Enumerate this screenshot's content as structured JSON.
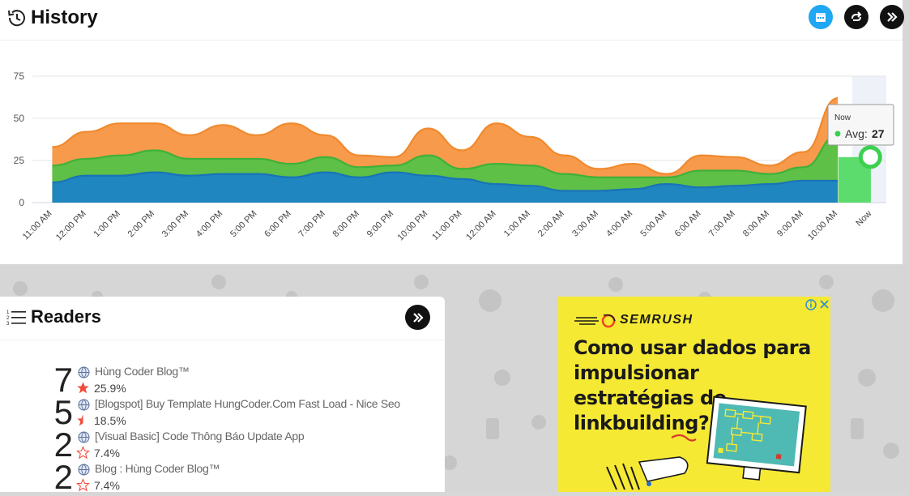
{
  "header": {
    "title": "History",
    "buttons": {
      "calendar": "calendar-icon",
      "refresh": "refresh-icon",
      "next": "double-chevron-right-icon"
    }
  },
  "colors": {
    "orange": "#f79a4b",
    "green": "#5ec046",
    "blue": "#1f86bf",
    "now_bar": "#5ddc6e"
  },
  "chart_data": {
    "type": "area",
    "ylim": [
      0,
      75
    ],
    "yticks": [
      0,
      25,
      50,
      75
    ],
    "x": [
      "11:00 AM",
      "12:00 PM",
      "1:00 PM",
      "2:00 PM",
      "3:00 PM",
      "4:00 PM",
      "5:00 PM",
      "6:00 PM",
      "7:00 PM",
      "8:00 PM",
      "9:00 PM",
      "10:00 PM",
      "11:00 PM",
      "12:00 AM",
      "1:00 AM",
      "2:00 AM",
      "3:00 AM",
      "4:00 AM",
      "5:00 AM",
      "6:00 AM",
      "7:00 AM",
      "8:00 AM",
      "9:00 AM",
      "10:00 AM",
      "Now"
    ],
    "series": [
      {
        "color": "#f79a4b",
        "values": [
          33,
          42,
          47,
          47,
          40,
          46,
          40,
          47,
          40,
          28,
          27,
          44,
          31,
          47,
          39,
          28,
          20,
          23,
          17,
          28,
          27,
          22,
          30,
          62,
          null
        ]
      },
      {
        "color": "#5ec046",
        "values": [
          22,
          26,
          28,
          31,
          26,
          26,
          26,
          23,
          27,
          21,
          22,
          28,
          20,
          23,
          22,
          17,
          15,
          15,
          15,
          19,
          19,
          17,
          21,
          40,
          27
        ]
      },
      {
        "color": "#1f86bf",
        "values": [
          12,
          16,
          16,
          18,
          16,
          17,
          17,
          15,
          18,
          15,
          18,
          16,
          14,
          11,
          10,
          7,
          7,
          8,
          11,
          9,
          10,
          11,
          13,
          13,
          null
        ]
      }
    ],
    "tooltip": {
      "label": "Now",
      "series_label": "Avg:",
      "value": "27"
    }
  },
  "readers": {
    "title": "Readers",
    "items": [
      {
        "count": "7",
        "name": "Hùng Coder Blog™",
        "percent": "25.9%",
        "star": "full"
      },
      {
        "count": "5",
        "name": "[Blogspot] Buy Template HungCoder.Com Fast Load - Nice Seo",
        "percent": "18.5%",
        "star": "partial"
      },
      {
        "count": "2",
        "name": "[Visual Basic] Code Thông Báo Update App",
        "percent": "7.4%",
        "star": "empty"
      },
      {
        "count": "2",
        "name": "Blog : Hùng Coder Blog™",
        "percent": "7.4%",
        "star": "empty"
      }
    ]
  },
  "ad": {
    "brand": "SEMRUSH",
    "headline": "Como usar dados para impulsionar estratégias de linkbuilding?"
  }
}
